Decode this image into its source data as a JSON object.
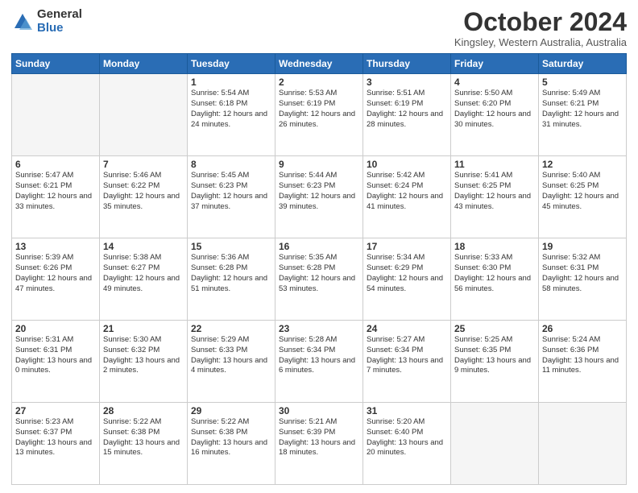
{
  "header": {
    "logo_general": "General",
    "logo_blue": "Blue",
    "title": "October 2024",
    "subtitle": "Kingsley, Western Australia, Australia"
  },
  "calendar": {
    "days_of_week": [
      "Sunday",
      "Monday",
      "Tuesday",
      "Wednesday",
      "Thursday",
      "Friday",
      "Saturday"
    ],
    "weeks": [
      [
        {
          "day": "",
          "info": "",
          "empty": true
        },
        {
          "day": "",
          "info": "",
          "empty": true
        },
        {
          "day": "1",
          "info": "Sunrise: 5:54 AM\nSunset: 6:18 PM\nDaylight: 12 hours and 24 minutes."
        },
        {
          "day": "2",
          "info": "Sunrise: 5:53 AM\nSunset: 6:19 PM\nDaylight: 12 hours and 26 minutes."
        },
        {
          "day": "3",
          "info": "Sunrise: 5:51 AM\nSunset: 6:19 PM\nDaylight: 12 hours and 28 minutes."
        },
        {
          "day": "4",
          "info": "Sunrise: 5:50 AM\nSunset: 6:20 PM\nDaylight: 12 hours and 30 minutes."
        },
        {
          "day": "5",
          "info": "Sunrise: 5:49 AM\nSunset: 6:21 PM\nDaylight: 12 hours and 31 minutes."
        }
      ],
      [
        {
          "day": "6",
          "info": "Sunrise: 5:47 AM\nSunset: 6:21 PM\nDaylight: 12 hours and 33 minutes."
        },
        {
          "day": "7",
          "info": "Sunrise: 5:46 AM\nSunset: 6:22 PM\nDaylight: 12 hours and 35 minutes."
        },
        {
          "day": "8",
          "info": "Sunrise: 5:45 AM\nSunset: 6:23 PM\nDaylight: 12 hours and 37 minutes."
        },
        {
          "day": "9",
          "info": "Sunrise: 5:44 AM\nSunset: 6:23 PM\nDaylight: 12 hours and 39 minutes."
        },
        {
          "day": "10",
          "info": "Sunrise: 5:42 AM\nSunset: 6:24 PM\nDaylight: 12 hours and 41 minutes."
        },
        {
          "day": "11",
          "info": "Sunrise: 5:41 AM\nSunset: 6:25 PM\nDaylight: 12 hours and 43 minutes."
        },
        {
          "day": "12",
          "info": "Sunrise: 5:40 AM\nSunset: 6:25 PM\nDaylight: 12 hours and 45 minutes."
        }
      ],
      [
        {
          "day": "13",
          "info": "Sunrise: 5:39 AM\nSunset: 6:26 PM\nDaylight: 12 hours and 47 minutes."
        },
        {
          "day": "14",
          "info": "Sunrise: 5:38 AM\nSunset: 6:27 PM\nDaylight: 12 hours and 49 minutes."
        },
        {
          "day": "15",
          "info": "Sunrise: 5:36 AM\nSunset: 6:28 PM\nDaylight: 12 hours and 51 minutes."
        },
        {
          "day": "16",
          "info": "Sunrise: 5:35 AM\nSunset: 6:28 PM\nDaylight: 12 hours and 53 minutes."
        },
        {
          "day": "17",
          "info": "Sunrise: 5:34 AM\nSunset: 6:29 PM\nDaylight: 12 hours and 54 minutes."
        },
        {
          "day": "18",
          "info": "Sunrise: 5:33 AM\nSunset: 6:30 PM\nDaylight: 12 hours and 56 minutes."
        },
        {
          "day": "19",
          "info": "Sunrise: 5:32 AM\nSunset: 6:31 PM\nDaylight: 12 hours and 58 minutes."
        }
      ],
      [
        {
          "day": "20",
          "info": "Sunrise: 5:31 AM\nSunset: 6:31 PM\nDaylight: 13 hours and 0 minutes."
        },
        {
          "day": "21",
          "info": "Sunrise: 5:30 AM\nSunset: 6:32 PM\nDaylight: 13 hours and 2 minutes."
        },
        {
          "day": "22",
          "info": "Sunrise: 5:29 AM\nSunset: 6:33 PM\nDaylight: 13 hours and 4 minutes."
        },
        {
          "day": "23",
          "info": "Sunrise: 5:28 AM\nSunset: 6:34 PM\nDaylight: 13 hours and 6 minutes."
        },
        {
          "day": "24",
          "info": "Sunrise: 5:27 AM\nSunset: 6:34 PM\nDaylight: 13 hours and 7 minutes."
        },
        {
          "day": "25",
          "info": "Sunrise: 5:25 AM\nSunset: 6:35 PM\nDaylight: 13 hours and 9 minutes."
        },
        {
          "day": "26",
          "info": "Sunrise: 5:24 AM\nSunset: 6:36 PM\nDaylight: 13 hours and 11 minutes."
        }
      ],
      [
        {
          "day": "27",
          "info": "Sunrise: 5:23 AM\nSunset: 6:37 PM\nDaylight: 13 hours and 13 minutes."
        },
        {
          "day": "28",
          "info": "Sunrise: 5:22 AM\nSunset: 6:38 PM\nDaylight: 13 hours and 15 minutes."
        },
        {
          "day": "29",
          "info": "Sunrise: 5:22 AM\nSunset: 6:38 PM\nDaylight: 13 hours and 16 minutes."
        },
        {
          "day": "30",
          "info": "Sunrise: 5:21 AM\nSunset: 6:39 PM\nDaylight: 13 hours and 18 minutes."
        },
        {
          "day": "31",
          "info": "Sunrise: 5:20 AM\nSunset: 6:40 PM\nDaylight: 13 hours and 20 minutes."
        },
        {
          "day": "",
          "info": "",
          "empty": true
        },
        {
          "day": "",
          "info": "",
          "empty": true
        }
      ]
    ]
  }
}
